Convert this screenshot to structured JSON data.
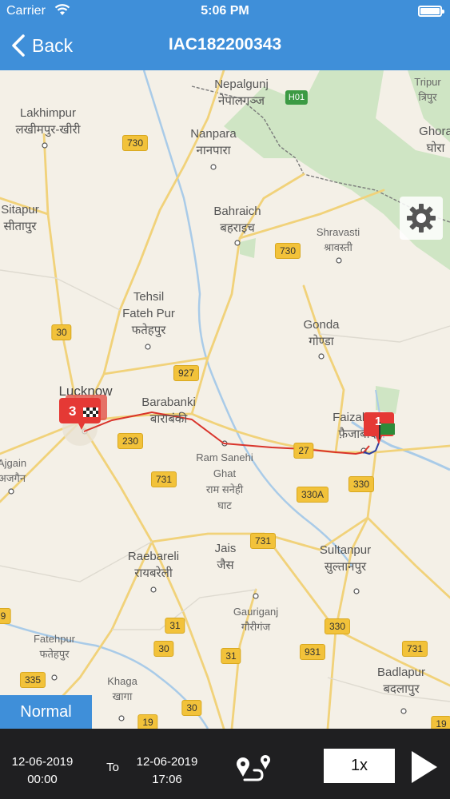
{
  "status_bar": {
    "carrier": "Carrier",
    "time": "5:06 PM"
  },
  "nav": {
    "back_label": "Back",
    "title": "IAC182200343"
  },
  "map": {
    "places": [
      {
        "id": "nepalgunj",
        "en": "Nepalgunj",
        "hi": "नेपालगञ्ज"
      },
      {
        "id": "tripur",
        "en": "Tripur",
        "hi": "त्रिपुर"
      },
      {
        "id": "lakhimpur",
        "en": "Lakhimpur",
        "hi": "लखीमपुर-खीरी"
      },
      {
        "id": "ghora",
        "en": "Ghora",
        "hi": "घोरा"
      },
      {
        "id": "nanpara",
        "en": "Nanpara",
        "hi": "नानपारा"
      },
      {
        "id": "sitapur",
        "en": "Sitapur",
        "hi": "सीतापुर"
      },
      {
        "id": "bahraich",
        "en": "Bahraich",
        "hi": "बहराइच"
      },
      {
        "id": "shravasti",
        "en": "Shravasti",
        "hi": "श्रावस्ती"
      },
      {
        "id": "tehsil",
        "en": "Tehsil\nFateh Pur",
        "hi": "फतेहपुर"
      },
      {
        "id": "gonda",
        "en": "Gonda",
        "hi": "गोण्डा"
      },
      {
        "id": "lucknow",
        "en": "Lucknow",
        "hi": ""
      },
      {
        "id": "barabanki",
        "en": "Barabanki",
        "hi": "बाराबंकी"
      },
      {
        "id": "faizabad",
        "en": "Faizabad",
        "hi": "फ़ैजाबाद"
      },
      {
        "id": "ajgain",
        "en": "Ajgain",
        "hi": "अजगैन"
      },
      {
        "id": "ramsanehi",
        "en": "Ram Sanehi\nGhat",
        "hi": "राम सनेही\nघाट"
      },
      {
        "id": "raebareli",
        "en": "Raebareli",
        "hi": "रायबरेली"
      },
      {
        "id": "jais",
        "en": "Jais",
        "hi": "जैस"
      },
      {
        "id": "sultanpur",
        "en": "Sultanpur",
        "hi": "सुल्तानपुर"
      },
      {
        "id": "gauriganj",
        "en": "Gauriganj",
        "hi": "गौरीगंज"
      },
      {
        "id": "fatehpur",
        "en": "Fatehpur",
        "hi": "फतेहपुर"
      },
      {
        "id": "khaga",
        "en": "Khaga",
        "hi": "खागा"
      },
      {
        "id": "badlapur",
        "en": "Badlapur",
        "hi": "बदलापुर"
      }
    ],
    "road_shields": [
      "730",
      "730",
      "30",
      "927",
      "230",
      "27",
      "731",
      "330",
      "330A",
      "731",
      "31",
      "30",
      "330",
      "931",
      "31",
      "731",
      "335",
      "30",
      "19",
      "9",
      "19"
    ],
    "highway_shield": "H01",
    "markers": {
      "start_count": "3",
      "end_count": "1"
    },
    "colors": {
      "route": "#d9342b",
      "marker": "#e53935",
      "flag": "#2e8b3a"
    }
  },
  "controls": {
    "map_type_label": "Normal"
  },
  "bottom_bar": {
    "from_date": "12-06-2019",
    "from_time": "00:00",
    "to_label": "To",
    "to_date": "12-06-2019",
    "to_time": "17:06",
    "speed_label": "1x"
  },
  "icons": {
    "settings": "gear-icon",
    "route": "route-icon",
    "play": "play-icon",
    "back": "chevron-left-icon"
  }
}
